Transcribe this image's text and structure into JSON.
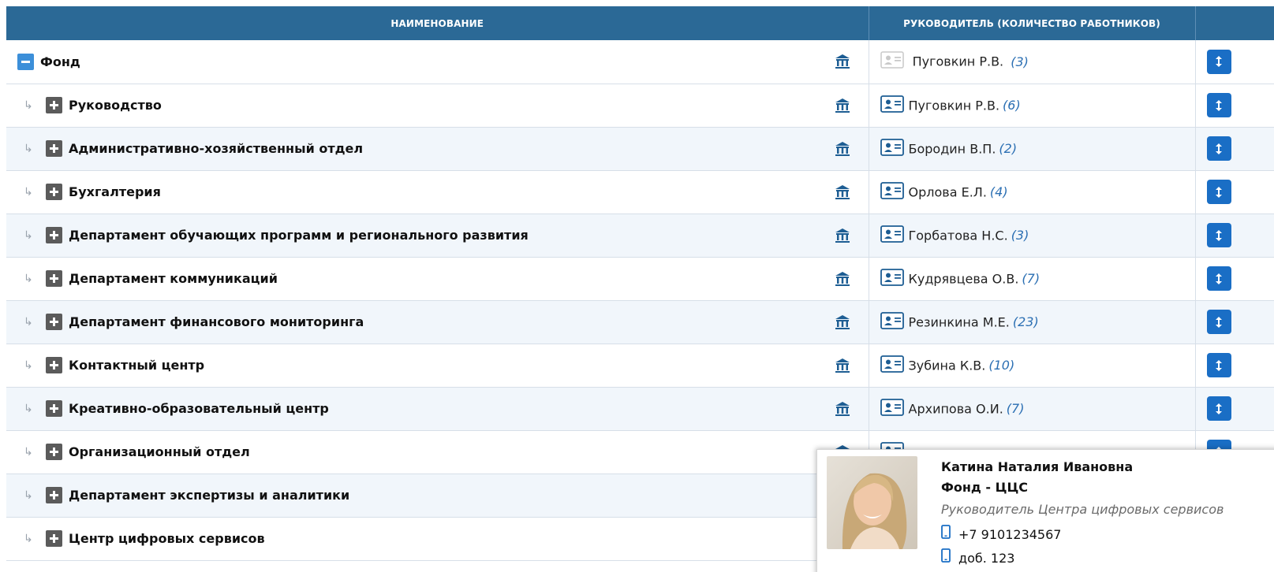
{
  "table": {
    "columns": {
      "name": "НАИМЕНОВАНИЕ",
      "head": "РУКОВОДИТЕЛЬ (КОЛИЧЕСТВО РАБОТНИКОВ)",
      "actions": ""
    },
    "root": {
      "name": "Фонд",
      "head": "Пуговкин Р.В.",
      "count": "(3)"
    },
    "rows": [
      {
        "name": "Руководство",
        "head": "Пуговкин Р.В.",
        "count": "(6)"
      },
      {
        "name": "Административно-хозяйственный отдел",
        "head": "Бородин В.П.",
        "count": "(2)"
      },
      {
        "name": "Бухгалтерия",
        "head": "Орлова Е.Л.",
        "count": "(4)"
      },
      {
        "name": "Департамент обучающих программ и регионального развития",
        "head": "Горбатова Н.С.",
        "count": "(3)"
      },
      {
        "name": "Департамент коммуникаций",
        "head": "Кудрявцева О.В.",
        "count": "(7)"
      },
      {
        "name": "Департамент финансового мониторинга",
        "head": "Резинкина М.Е.",
        "count": "(23)"
      },
      {
        "name": "Контактный центр",
        "head": "Зубина К.В.",
        "count": "(10)"
      },
      {
        "name": "Креативно-образовательный центр",
        "head": "Архипова О.И.",
        "count": "(7)"
      },
      {
        "name": "Организационный отдел",
        "head": "",
        "count": ""
      },
      {
        "name": "Департамент экспертизы и аналитики",
        "head": "",
        "count": ""
      },
      {
        "name": "Центр цифровых сервисов",
        "head": "",
        "count": ""
      }
    ]
  },
  "popup": {
    "name": "Катина Наталия Ивановна",
    "org": "Фонд - ЦЦС",
    "position": "Руководитель Центра цифровых сервисов",
    "phone": "+7 9101234567",
    "ext": "доб. 123"
  },
  "colors": {
    "header_bg": "#2b6996",
    "accent": "#1a6ec5",
    "count_text": "#2b6fb3",
    "stripe": "#f1f6fb"
  }
}
